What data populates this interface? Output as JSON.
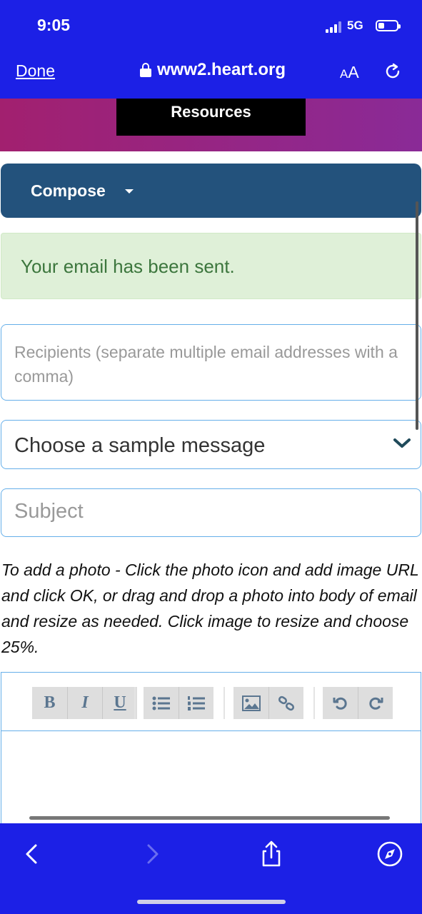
{
  "status_bar": {
    "time": "9:05",
    "network": "5G",
    "icons": [
      "signal-icon",
      "battery-icon"
    ]
  },
  "browser": {
    "done_label": "Done",
    "url": "www2.heart.org",
    "text_size_small": "A",
    "text_size_big": "A",
    "icons": [
      "lock-icon",
      "reload-icon",
      "back-icon",
      "forward-icon",
      "share-icon",
      "compass-icon"
    ]
  },
  "header": {
    "resources_label": "Resources"
  },
  "compose": {
    "label": "Compose"
  },
  "alert": {
    "message": "Your email has been sent."
  },
  "form": {
    "recipients_placeholder": "Recipients (separate multiple email addresses with a comma)",
    "sample_message_value": "Choose a sample message",
    "subject_placeholder": "Subject",
    "photo_instructions": "To add a photo - Click the photo icon and add image URL and click OK, or drag and drop a photo into body of email and resize as needed. Click image to resize and choose 25%."
  },
  "toolbar": {
    "bold": "B",
    "italic": "I",
    "underline": "U",
    "icons": [
      "bullet-list-icon",
      "numbered-list-icon",
      "image-icon",
      "link-icon",
      "undo-icon",
      "redo-icon"
    ]
  },
  "colors": {
    "chrome_blue": "#1c20e6",
    "compose_blue": "#23527c",
    "alert_bg": "#dff0d8",
    "alert_text": "#3c763d",
    "field_border": "#66afe9"
  }
}
